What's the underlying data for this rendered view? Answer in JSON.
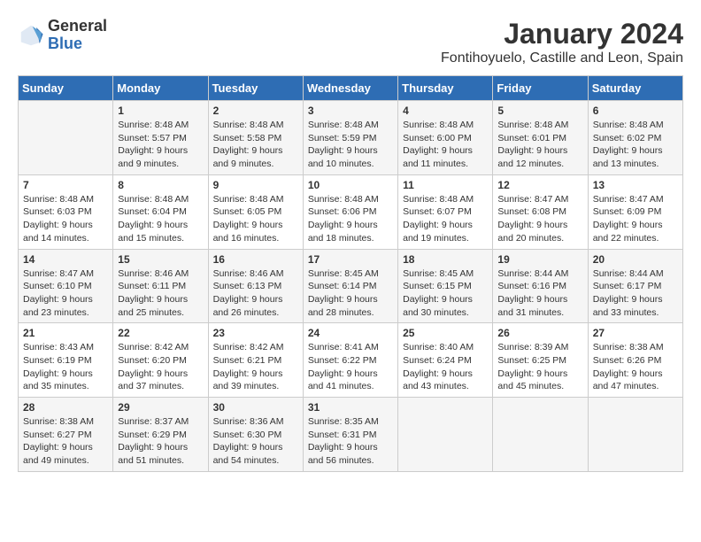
{
  "header": {
    "logo_general": "General",
    "logo_blue": "Blue",
    "month_title": "January 2024",
    "location": "Fontihoyuelo, Castille and Leon, Spain"
  },
  "columns": [
    "Sunday",
    "Monday",
    "Tuesday",
    "Wednesday",
    "Thursday",
    "Friday",
    "Saturday"
  ],
  "weeks": [
    [
      {
        "day": "",
        "sunrise": "",
        "sunset": "",
        "daylight": ""
      },
      {
        "day": "1",
        "sunrise": "Sunrise: 8:48 AM",
        "sunset": "Sunset: 5:57 PM",
        "daylight": "Daylight: 9 hours and 9 minutes."
      },
      {
        "day": "2",
        "sunrise": "Sunrise: 8:48 AM",
        "sunset": "Sunset: 5:58 PM",
        "daylight": "Daylight: 9 hours and 9 minutes."
      },
      {
        "day": "3",
        "sunrise": "Sunrise: 8:48 AM",
        "sunset": "Sunset: 5:59 PM",
        "daylight": "Daylight: 9 hours and 10 minutes."
      },
      {
        "day": "4",
        "sunrise": "Sunrise: 8:48 AM",
        "sunset": "Sunset: 6:00 PM",
        "daylight": "Daylight: 9 hours and 11 minutes."
      },
      {
        "day": "5",
        "sunrise": "Sunrise: 8:48 AM",
        "sunset": "Sunset: 6:01 PM",
        "daylight": "Daylight: 9 hours and 12 minutes."
      },
      {
        "day": "6",
        "sunrise": "Sunrise: 8:48 AM",
        "sunset": "Sunset: 6:02 PM",
        "daylight": "Daylight: 9 hours and 13 minutes."
      }
    ],
    [
      {
        "day": "7",
        "sunrise": "Sunrise: 8:48 AM",
        "sunset": "Sunset: 6:03 PM",
        "daylight": "Daylight: 9 hours and 14 minutes."
      },
      {
        "day": "8",
        "sunrise": "Sunrise: 8:48 AM",
        "sunset": "Sunset: 6:04 PM",
        "daylight": "Daylight: 9 hours and 15 minutes."
      },
      {
        "day": "9",
        "sunrise": "Sunrise: 8:48 AM",
        "sunset": "Sunset: 6:05 PM",
        "daylight": "Daylight: 9 hours and 16 minutes."
      },
      {
        "day": "10",
        "sunrise": "Sunrise: 8:48 AM",
        "sunset": "Sunset: 6:06 PM",
        "daylight": "Daylight: 9 hours and 18 minutes."
      },
      {
        "day": "11",
        "sunrise": "Sunrise: 8:48 AM",
        "sunset": "Sunset: 6:07 PM",
        "daylight": "Daylight: 9 hours and 19 minutes."
      },
      {
        "day": "12",
        "sunrise": "Sunrise: 8:47 AM",
        "sunset": "Sunset: 6:08 PM",
        "daylight": "Daylight: 9 hours and 20 minutes."
      },
      {
        "day": "13",
        "sunrise": "Sunrise: 8:47 AM",
        "sunset": "Sunset: 6:09 PM",
        "daylight": "Daylight: 9 hours and 22 minutes."
      }
    ],
    [
      {
        "day": "14",
        "sunrise": "Sunrise: 8:47 AM",
        "sunset": "Sunset: 6:10 PM",
        "daylight": "Daylight: 9 hours and 23 minutes."
      },
      {
        "day": "15",
        "sunrise": "Sunrise: 8:46 AM",
        "sunset": "Sunset: 6:11 PM",
        "daylight": "Daylight: 9 hours and 25 minutes."
      },
      {
        "day": "16",
        "sunrise": "Sunrise: 8:46 AM",
        "sunset": "Sunset: 6:13 PM",
        "daylight": "Daylight: 9 hours and 26 minutes."
      },
      {
        "day": "17",
        "sunrise": "Sunrise: 8:45 AM",
        "sunset": "Sunset: 6:14 PM",
        "daylight": "Daylight: 9 hours and 28 minutes."
      },
      {
        "day": "18",
        "sunrise": "Sunrise: 8:45 AM",
        "sunset": "Sunset: 6:15 PM",
        "daylight": "Daylight: 9 hours and 30 minutes."
      },
      {
        "day": "19",
        "sunrise": "Sunrise: 8:44 AM",
        "sunset": "Sunset: 6:16 PM",
        "daylight": "Daylight: 9 hours and 31 minutes."
      },
      {
        "day": "20",
        "sunrise": "Sunrise: 8:44 AM",
        "sunset": "Sunset: 6:17 PM",
        "daylight": "Daylight: 9 hours and 33 minutes."
      }
    ],
    [
      {
        "day": "21",
        "sunrise": "Sunrise: 8:43 AM",
        "sunset": "Sunset: 6:19 PM",
        "daylight": "Daylight: 9 hours and 35 minutes."
      },
      {
        "day": "22",
        "sunrise": "Sunrise: 8:42 AM",
        "sunset": "Sunset: 6:20 PM",
        "daylight": "Daylight: 9 hours and 37 minutes."
      },
      {
        "day": "23",
        "sunrise": "Sunrise: 8:42 AM",
        "sunset": "Sunset: 6:21 PM",
        "daylight": "Daylight: 9 hours and 39 minutes."
      },
      {
        "day": "24",
        "sunrise": "Sunrise: 8:41 AM",
        "sunset": "Sunset: 6:22 PM",
        "daylight": "Daylight: 9 hours and 41 minutes."
      },
      {
        "day": "25",
        "sunrise": "Sunrise: 8:40 AM",
        "sunset": "Sunset: 6:24 PM",
        "daylight": "Daylight: 9 hours and 43 minutes."
      },
      {
        "day": "26",
        "sunrise": "Sunrise: 8:39 AM",
        "sunset": "Sunset: 6:25 PM",
        "daylight": "Daylight: 9 hours and 45 minutes."
      },
      {
        "day": "27",
        "sunrise": "Sunrise: 8:38 AM",
        "sunset": "Sunset: 6:26 PM",
        "daylight": "Daylight: 9 hours and 47 minutes."
      }
    ],
    [
      {
        "day": "28",
        "sunrise": "Sunrise: 8:38 AM",
        "sunset": "Sunset: 6:27 PM",
        "daylight": "Daylight: 9 hours and 49 minutes."
      },
      {
        "day": "29",
        "sunrise": "Sunrise: 8:37 AM",
        "sunset": "Sunset: 6:29 PM",
        "daylight": "Daylight: 9 hours and 51 minutes."
      },
      {
        "day": "30",
        "sunrise": "Sunrise: 8:36 AM",
        "sunset": "Sunset: 6:30 PM",
        "daylight": "Daylight: 9 hours and 54 minutes."
      },
      {
        "day": "31",
        "sunrise": "Sunrise: 8:35 AM",
        "sunset": "Sunset: 6:31 PM",
        "daylight": "Daylight: 9 hours and 56 minutes."
      },
      {
        "day": "",
        "sunrise": "",
        "sunset": "",
        "daylight": ""
      },
      {
        "day": "",
        "sunrise": "",
        "sunset": "",
        "daylight": ""
      },
      {
        "day": "",
        "sunrise": "",
        "sunset": "",
        "daylight": ""
      }
    ]
  ]
}
